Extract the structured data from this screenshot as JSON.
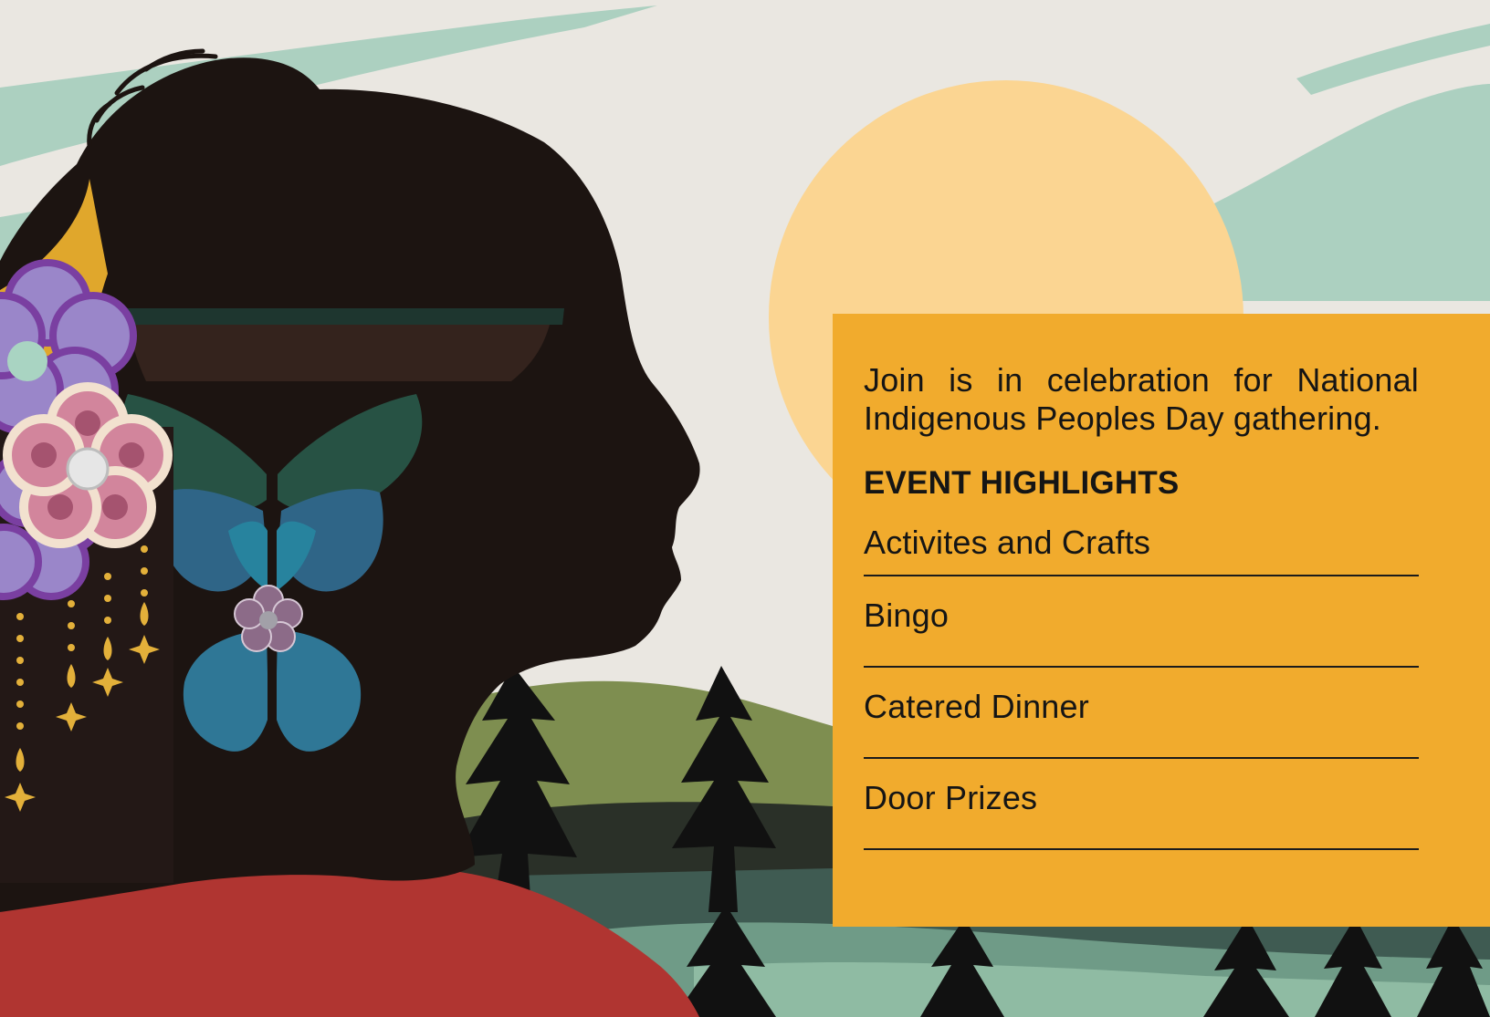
{
  "panel": {
    "intro": "Join is in celebration for National Indigenous Peoples Day gathering.",
    "highlights_title": "EVENT HIGHLIGHTS",
    "highlights": [
      "Activites and Crafts",
      "Bingo",
      "Catered Dinner",
      "Door Prizes"
    ]
  },
  "colors": {
    "panel": "#f1ab2d",
    "sky": "#eae7e1",
    "sky_brush": "#acd0c0",
    "sun": "#fbd592",
    "silhouette": "#1c1411",
    "shirt": "#b03531",
    "hill": "#7e8e50",
    "lake": "#3f5b52",
    "tree": "#111111",
    "flower_purple": "#7a3fa1",
    "flower_pink": "#d2859c"
  },
  "icons": {
    "flower": "beaded-flower-icon",
    "butterfly": "butterfly-icon",
    "tree": "pine-tree-icon",
    "sun": "sun-icon",
    "sparkle": "sparkle-icon"
  }
}
